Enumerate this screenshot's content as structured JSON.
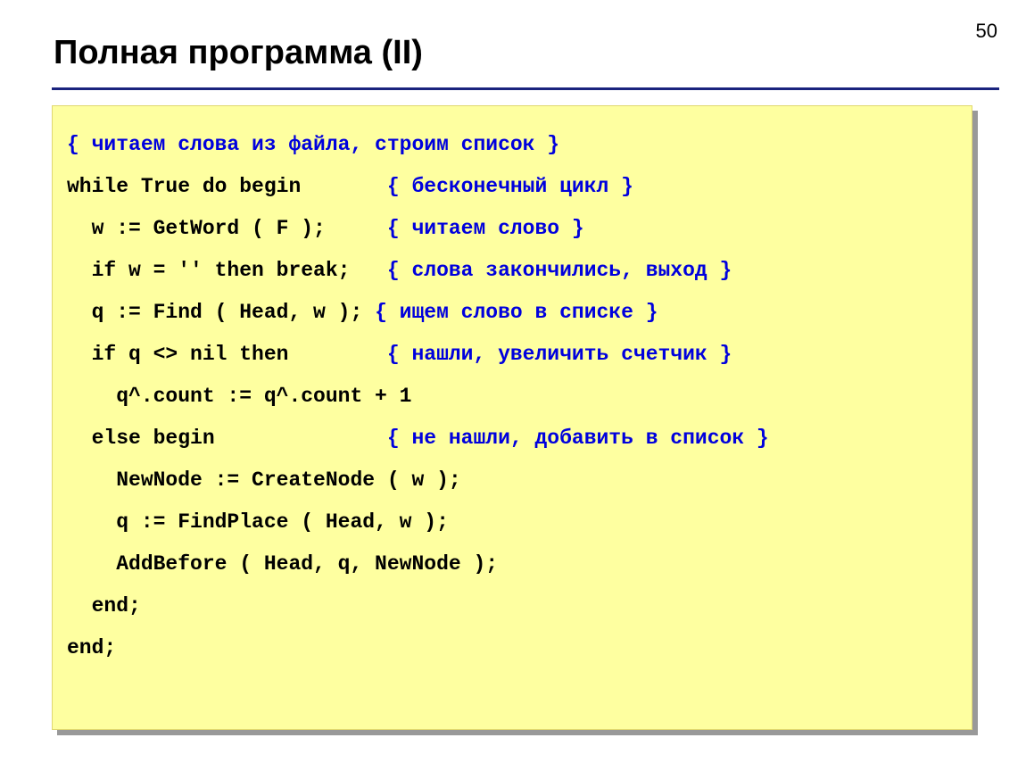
{
  "pageNumber": "50",
  "title": "Полная программа (II)",
  "code": {
    "line1_comment": "{ читаем слова из файла, строим список }",
    "line2_code": "while True do begin       ",
    "line2_comment": "{ бесконечный цикл }",
    "line3_code": "  w := GetWord ( F );     ",
    "line3_comment": "{ читаем слово }",
    "line4_code": "  if w = '' then break;   ",
    "line4_comment": "{ слова закончились, выход }",
    "line5_code": "  q := Find ( Head, w ); ",
    "line5_comment": "{ ищем слово в списке }",
    "line6_code": "  if q <> nil then        ",
    "line6_comment": "{ нашли, увеличить счетчик }",
    "line7_code": "    q^.count := q^.count + 1",
    "line8_code": "  else begin              ",
    "line8_comment": "{ не нашли, добавить в список }",
    "line9_code": "    NewNode := CreateNode ( w );",
    "line10_code": "    q := FindPlace ( Head, w );",
    "line11_code": "    AddBefore ( Head, q, NewNode );",
    "line12_code": "  end;",
    "line13_code": "end;"
  }
}
